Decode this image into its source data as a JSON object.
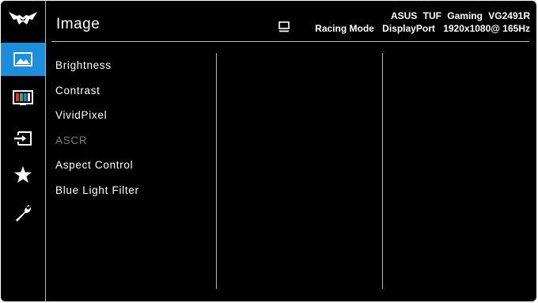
{
  "header": {
    "title": "Image",
    "model": "ASUS TUF Gaming  VG2491R",
    "mode": "Racing Mode",
    "input": "DisplayPort",
    "resolution": "1920x1080@ 165Hz"
  },
  "sidebar": {
    "items": [
      {
        "icon": "image-icon",
        "active": true
      },
      {
        "icon": "color-icon",
        "active": false
      },
      {
        "icon": "input-select-icon",
        "active": false
      },
      {
        "icon": "star-icon",
        "active": false
      },
      {
        "icon": "system-setup-icon",
        "active": false
      }
    ]
  },
  "menu": {
    "items": [
      {
        "label": "Brightness",
        "enabled": true
      },
      {
        "label": "Contrast",
        "enabled": true
      },
      {
        "label": "VividPixel",
        "enabled": true
      },
      {
        "label": "ASCR",
        "enabled": false
      },
      {
        "label": "Aspect Control",
        "enabled": true
      },
      {
        "label": "Blue Light Filter",
        "enabled": true
      }
    ]
  },
  "colors": {
    "accent": "#1b8fdc",
    "background": "#000000",
    "text": "#ffffff",
    "disabled_text": "#7a7a7a",
    "divider": "#b8b8b8"
  }
}
